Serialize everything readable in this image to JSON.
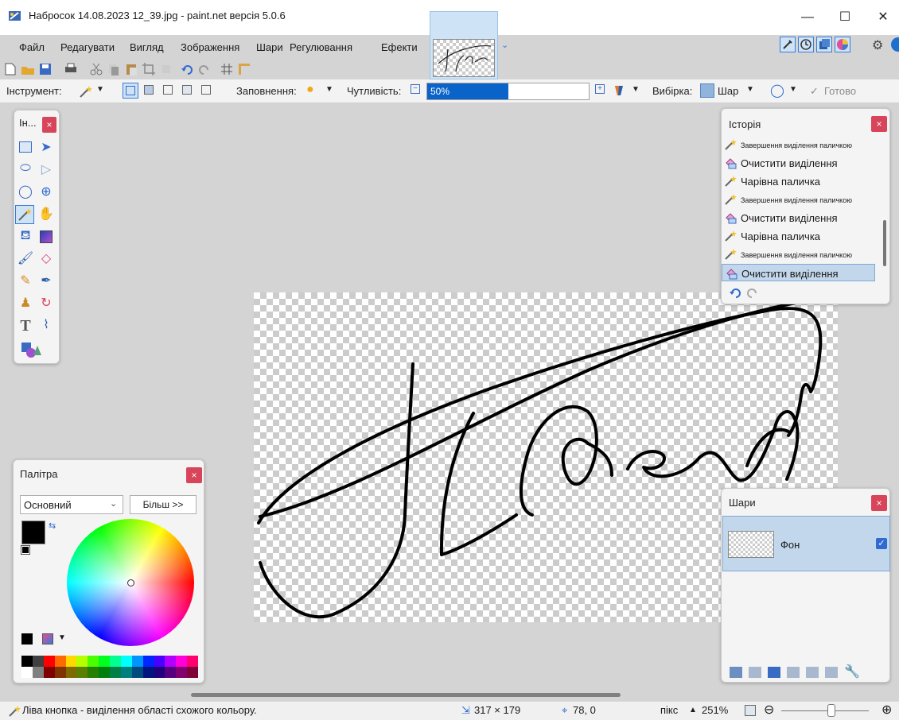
{
  "window": {
    "title": "Набросок 14.08.2023 12_39.jpg - paint.net версія 5.0.6",
    "minimize_glyph": "—",
    "maximize_glyph": "☐",
    "close_glyph": "✕"
  },
  "menu": {
    "items": [
      "Файл",
      "Редагувати",
      "Вигляд",
      "Зображення",
      "Шари",
      "Регулювання",
      "Ефекти"
    ]
  },
  "options_bar": {
    "tool_label": "Інструмент:",
    "fill_label": "Заповнення:",
    "tolerance_label": "Чутливість:",
    "tolerance_value": "50%",
    "tolerance_fraction": 0.5,
    "sampling_label": "Вибірка:",
    "sampling_value": "Шар",
    "done_label": "Готово"
  },
  "tools_panel": {
    "title": "Ін...",
    "close": "×"
  },
  "history_panel": {
    "title": "Історія",
    "close": "×",
    "items": [
      {
        "label": "Завершення виділення паличкою",
        "icon": "magic-wand-icon",
        "small": true
      },
      {
        "label": "Очистити виділення",
        "icon": "eraser-selection-icon",
        "small": false
      },
      {
        "label": "Чарівна паличка",
        "icon": "magic-wand-icon",
        "small": false
      },
      {
        "label": "Завершення виділення паличкою",
        "icon": "magic-wand-icon",
        "small": true
      },
      {
        "label": "Очистити виділення",
        "icon": "eraser-selection-icon",
        "small": false
      },
      {
        "label": "Чарівна паличка",
        "icon": "magic-wand-icon",
        "small": false
      },
      {
        "label": "Завершення виділення паличкою",
        "icon": "magic-wand-icon",
        "small": true
      },
      {
        "label": "Очистити виділення",
        "icon": "eraser-selection-icon",
        "small": false,
        "selected": true
      }
    ]
  },
  "layers_panel": {
    "title": "Шари",
    "close": "×",
    "layer_name": "Фон"
  },
  "palette_panel": {
    "title": "Палітра",
    "close": "×",
    "palette_select": "Основний",
    "more_button": "Більш >>"
  },
  "status": {
    "hint": "Ліва кнопка - виділення області схожого кольору.",
    "selection_size": "317 × 179",
    "cursor_pos": "78, 0",
    "units": "пікс",
    "zoom": "251%"
  },
  "colors": {
    "accent": "#0a63c9",
    "close_button": "#d8455a",
    "selected_row": "#c2d7ec"
  }
}
